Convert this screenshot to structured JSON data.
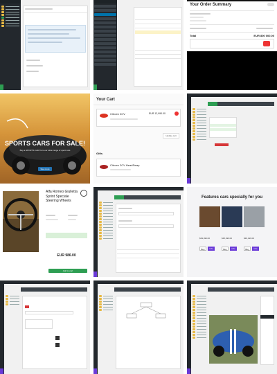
{
  "order_summary": {
    "title": "Your Order Summary",
    "total_label": "Total",
    "total_value": "EUR 800 000.00"
  },
  "sports_banner": {
    "headline": "SPORTS CARS FOR SALE!",
    "subline": "Buy a SPORTS CAR from our wide range of sport cars",
    "button": "See more"
  },
  "cart": {
    "title": "Your Cart",
    "item1_name": "Citroen 2CV",
    "item1_price": "EUR 12,990.00",
    "item2_name": "Citroen 2CV HeadSwap",
    "section": "Gifts",
    "update_button": "Update cart"
  },
  "product": {
    "title": "Alfa Romeo Giulietta Sprint Speciale Steering Wheels",
    "price": "EUR 986.00",
    "buy_button": "Add to cart"
  },
  "features": {
    "title": "Features cars specially for you",
    "cards": [
      {
        "price": "$39,499.00",
        "btn1": "Buy",
        "btn2": "Info"
      },
      {
        "price": "$35,499.00",
        "btn1": "Buy",
        "btn2": "Info"
      },
      {
        "price": "$39,199.00",
        "btn1": "Buy",
        "btn2": "Info"
      }
    ]
  },
  "admin": {
    "accent": "#0073aa",
    "sidebar_bg": "#23282d",
    "wp_green": "#2e9e53"
  }
}
